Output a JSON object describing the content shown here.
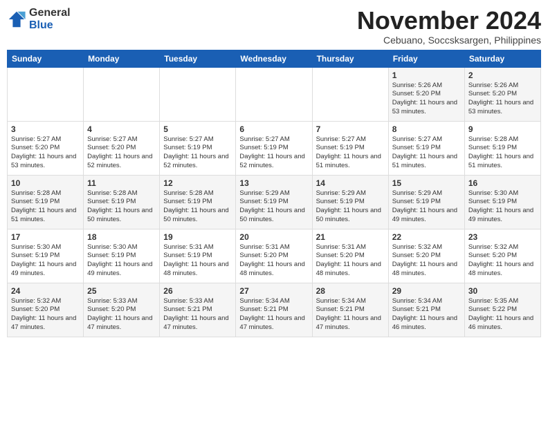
{
  "logo": {
    "general": "General",
    "blue": "Blue"
  },
  "header": {
    "month": "November 2024",
    "location": "Cebuano, Soccsksargen, Philippines"
  },
  "weekdays": [
    "Sunday",
    "Monday",
    "Tuesday",
    "Wednesday",
    "Thursday",
    "Friday",
    "Saturday"
  ],
  "weeks": [
    [
      {
        "day": "",
        "info": ""
      },
      {
        "day": "",
        "info": ""
      },
      {
        "day": "",
        "info": ""
      },
      {
        "day": "",
        "info": ""
      },
      {
        "day": "",
        "info": ""
      },
      {
        "day": "1",
        "info": "Sunrise: 5:26 AM\nSunset: 5:20 PM\nDaylight: 11 hours and 53 minutes."
      },
      {
        "day": "2",
        "info": "Sunrise: 5:26 AM\nSunset: 5:20 PM\nDaylight: 11 hours and 53 minutes."
      }
    ],
    [
      {
        "day": "3",
        "info": "Sunrise: 5:27 AM\nSunset: 5:20 PM\nDaylight: 11 hours and 53 minutes."
      },
      {
        "day": "4",
        "info": "Sunrise: 5:27 AM\nSunset: 5:20 PM\nDaylight: 11 hours and 52 minutes."
      },
      {
        "day": "5",
        "info": "Sunrise: 5:27 AM\nSunset: 5:19 PM\nDaylight: 11 hours and 52 minutes."
      },
      {
        "day": "6",
        "info": "Sunrise: 5:27 AM\nSunset: 5:19 PM\nDaylight: 11 hours and 52 minutes."
      },
      {
        "day": "7",
        "info": "Sunrise: 5:27 AM\nSunset: 5:19 PM\nDaylight: 11 hours and 51 minutes."
      },
      {
        "day": "8",
        "info": "Sunrise: 5:27 AM\nSunset: 5:19 PM\nDaylight: 11 hours and 51 minutes."
      },
      {
        "day": "9",
        "info": "Sunrise: 5:28 AM\nSunset: 5:19 PM\nDaylight: 11 hours and 51 minutes."
      }
    ],
    [
      {
        "day": "10",
        "info": "Sunrise: 5:28 AM\nSunset: 5:19 PM\nDaylight: 11 hours and 51 minutes."
      },
      {
        "day": "11",
        "info": "Sunrise: 5:28 AM\nSunset: 5:19 PM\nDaylight: 11 hours and 50 minutes."
      },
      {
        "day": "12",
        "info": "Sunrise: 5:28 AM\nSunset: 5:19 PM\nDaylight: 11 hours and 50 minutes."
      },
      {
        "day": "13",
        "info": "Sunrise: 5:29 AM\nSunset: 5:19 PM\nDaylight: 11 hours and 50 minutes."
      },
      {
        "day": "14",
        "info": "Sunrise: 5:29 AM\nSunset: 5:19 PM\nDaylight: 11 hours and 50 minutes."
      },
      {
        "day": "15",
        "info": "Sunrise: 5:29 AM\nSunset: 5:19 PM\nDaylight: 11 hours and 49 minutes."
      },
      {
        "day": "16",
        "info": "Sunrise: 5:30 AM\nSunset: 5:19 PM\nDaylight: 11 hours and 49 minutes."
      }
    ],
    [
      {
        "day": "17",
        "info": "Sunrise: 5:30 AM\nSunset: 5:19 PM\nDaylight: 11 hours and 49 minutes."
      },
      {
        "day": "18",
        "info": "Sunrise: 5:30 AM\nSunset: 5:19 PM\nDaylight: 11 hours and 49 minutes."
      },
      {
        "day": "19",
        "info": "Sunrise: 5:31 AM\nSunset: 5:19 PM\nDaylight: 11 hours and 48 minutes."
      },
      {
        "day": "20",
        "info": "Sunrise: 5:31 AM\nSunset: 5:20 PM\nDaylight: 11 hours and 48 minutes."
      },
      {
        "day": "21",
        "info": "Sunrise: 5:31 AM\nSunset: 5:20 PM\nDaylight: 11 hours and 48 minutes."
      },
      {
        "day": "22",
        "info": "Sunrise: 5:32 AM\nSunset: 5:20 PM\nDaylight: 11 hours and 48 minutes."
      },
      {
        "day": "23",
        "info": "Sunrise: 5:32 AM\nSunset: 5:20 PM\nDaylight: 11 hours and 48 minutes."
      }
    ],
    [
      {
        "day": "24",
        "info": "Sunrise: 5:32 AM\nSunset: 5:20 PM\nDaylight: 11 hours and 47 minutes."
      },
      {
        "day": "25",
        "info": "Sunrise: 5:33 AM\nSunset: 5:20 PM\nDaylight: 11 hours and 47 minutes."
      },
      {
        "day": "26",
        "info": "Sunrise: 5:33 AM\nSunset: 5:21 PM\nDaylight: 11 hours and 47 minutes."
      },
      {
        "day": "27",
        "info": "Sunrise: 5:34 AM\nSunset: 5:21 PM\nDaylight: 11 hours and 47 minutes."
      },
      {
        "day": "28",
        "info": "Sunrise: 5:34 AM\nSunset: 5:21 PM\nDaylight: 11 hours and 47 minutes."
      },
      {
        "day": "29",
        "info": "Sunrise: 5:34 AM\nSunset: 5:21 PM\nDaylight: 11 hours and 46 minutes."
      },
      {
        "day": "30",
        "info": "Sunrise: 5:35 AM\nSunset: 5:22 PM\nDaylight: 11 hours and 46 minutes."
      }
    ]
  ]
}
